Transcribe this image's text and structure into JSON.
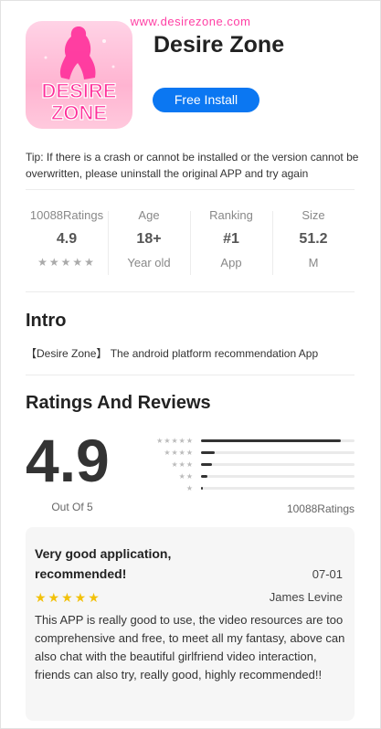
{
  "watermark": "www.desirezone.com",
  "app": {
    "icon_text_line1": "DESIRE",
    "icon_text_line2": "ZONE",
    "title": "Desire Zone",
    "install_label": "Free Install"
  },
  "tip": "Tip: If there is a crash or cannot be installed or the version cannot be overwritten, please uninstall the original APP and try again",
  "stats": {
    "ratings": {
      "label": "10088Ratings",
      "value": "4.9",
      "stars": "★★★★★"
    },
    "age": {
      "label": "Age",
      "value": "18+",
      "sub": "Year old"
    },
    "ranking": {
      "label": "Ranking",
      "value": "#1",
      "sub": "App"
    },
    "size": {
      "label": "Size",
      "value": "51.2",
      "sub": "M"
    }
  },
  "intro": {
    "title": "Intro",
    "text": "【Desire Zone】 The android platform recommendation App"
  },
  "ratings": {
    "title": "Ratings And Reviews",
    "score": "4.9",
    "out_of": "Out Of 5",
    "count": "10088Ratings",
    "distribution": [
      {
        "stars": "★★★★★",
        "fraction": 0.91
      },
      {
        "stars": "★★★★",
        "fraction": 0.09
      },
      {
        "stars": "★★★",
        "fraction": 0.07
      },
      {
        "stars": "★★",
        "fraction": 0.04
      },
      {
        "stars": "★",
        "fraction": 0.01
      }
    ]
  },
  "review": {
    "title": "Very good application, recommended!",
    "date": "07-01",
    "stars": "★★★★★",
    "rating": 5,
    "author": "James Levine",
    "body": "This APP is really good to use, the video resources are too comprehensive and free, to meet all my fantasy, above can also chat with the beautiful girlfriend video interaction, friends can also try, really good, highly recommended!!"
  },
  "colors": {
    "accent": "#0b77f2",
    "watermark": "#ff3fa4",
    "star": "#f2c10a"
  }
}
